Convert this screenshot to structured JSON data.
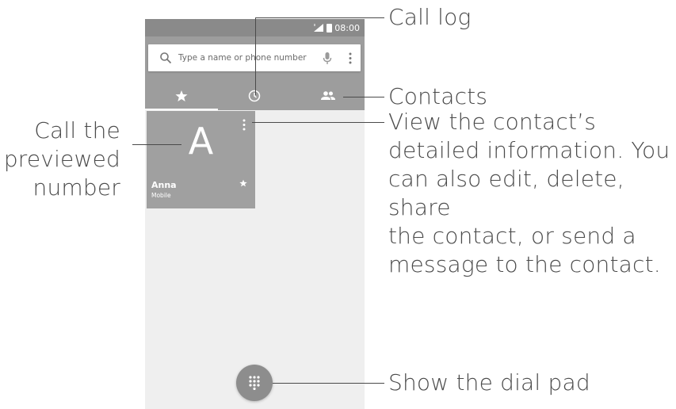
{
  "status_bar": {
    "time": "08:00"
  },
  "search": {
    "placeholder": "Type a name or phone number"
  },
  "tabs": [
    {
      "name": "favorites",
      "icon": "star-icon",
      "active": true
    },
    {
      "name": "call-log",
      "icon": "clock-icon",
      "active": false
    },
    {
      "name": "contacts",
      "icon": "people-icon",
      "active": false
    }
  ],
  "contact_card": {
    "initial": "A",
    "name": "Anna",
    "type": "Mobile"
  },
  "annotations": {
    "call_log": "Call log",
    "contacts": "Contacts",
    "view_details": [
      "View the contact’s",
      "detailed information. You",
      "can also edit, delete, share",
      "the contact, or send a",
      "message to the contact."
    ],
    "call_previewed": [
      "Call the",
      "previewed",
      "number"
    ],
    "dial_pad": "Show the dial pad"
  },
  "colors": {
    "status_bar": "#8a8a8a",
    "app_bar": "#9d9d9d",
    "card": "#a0a0a0",
    "fab": "#8d8d8d",
    "background": "#efefef"
  }
}
